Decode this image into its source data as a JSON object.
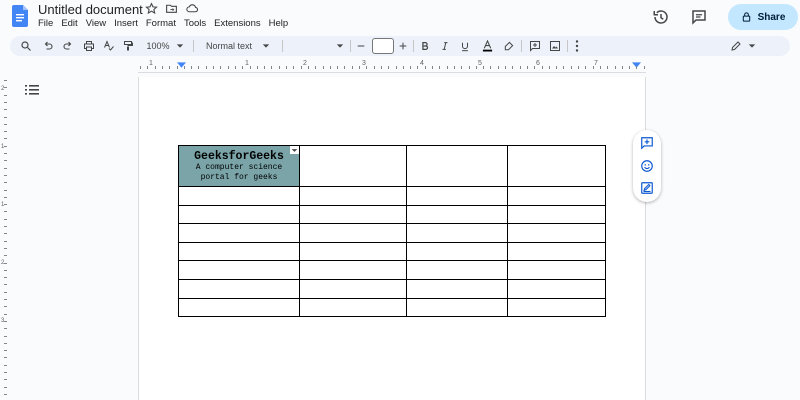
{
  "app": {
    "doc_title": "Untitled document"
  },
  "menu": [
    "File",
    "Edit",
    "View",
    "Insert",
    "Format",
    "Tools",
    "Extensions",
    "Help"
  ],
  "header": {
    "share_label": "Share"
  },
  "toolbar": {
    "zoom": "100%",
    "style": "Normal text",
    "font": "",
    "font_size": ""
  },
  "ruler": {
    "numbers": [
      "1",
      "1",
      "2",
      "3",
      "4",
      "5",
      "6",
      "7"
    ]
  },
  "vruler": {
    "numbers": [
      "2",
      "1",
      "1",
      "2",
      "3"
    ]
  },
  "table": {
    "cell_title": "GeeksforGeeks",
    "cell_subtitle": "A computer science portal for geeks",
    "rows": 8,
    "cols": 4,
    "cell_color": "#7aa4a8"
  },
  "colors": {
    "accent": "#1a73e8",
    "share_bg": "#c2e7ff",
    "toolbar_bg": "#edf2fa",
    "side_icon": "#0b57d0"
  },
  "icons": {
    "docs_logo": "docs-logo-icon",
    "star": "star-icon",
    "move": "folder-move-icon",
    "cloud": "cloud-status-icon",
    "history": "history-icon",
    "comment": "comment-icon",
    "lock": "lock-icon",
    "search": "search-icon",
    "undo": "undo-icon",
    "redo": "redo-icon",
    "print": "print-icon",
    "spellcheck": "spellcheck-icon",
    "paint_format": "paint-format-icon",
    "bold": "bold-icon",
    "italic": "italic-icon",
    "underline": "underline-icon",
    "text_color": "text-color-icon",
    "highlight": "highlight-icon",
    "link": "link-icon",
    "image": "image-icon",
    "more": "more-vert-icon",
    "editing": "pencil-icon",
    "outline": "outline-icon",
    "add_comment": "add-comment-icon",
    "emoji": "emoji-icon",
    "suggest": "suggest-edit-icon"
  }
}
